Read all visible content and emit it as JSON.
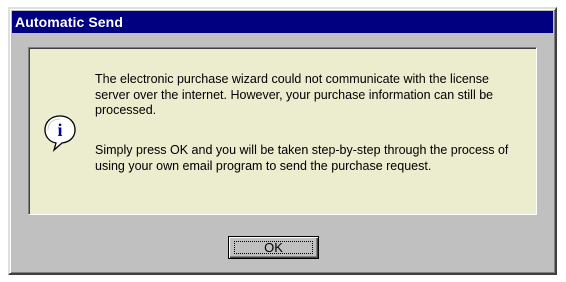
{
  "window": {
    "title": "Automatic Send"
  },
  "message": {
    "icon": "info-icon",
    "icon_glyph": "i",
    "paragraph1": "The electronic purchase wizard could not communicate with the license server over the internet. However, your purchase information can still be processed.",
    "paragraph2": "Simply press OK and you will be taken step-by-step through the process of using your own email program to send the purchase request."
  },
  "buttons": {
    "ok_label": "OK"
  },
  "colors": {
    "titlebar": "#000080",
    "dialog_face": "#c0c0c0",
    "panel_background": "#ffffe6"
  }
}
